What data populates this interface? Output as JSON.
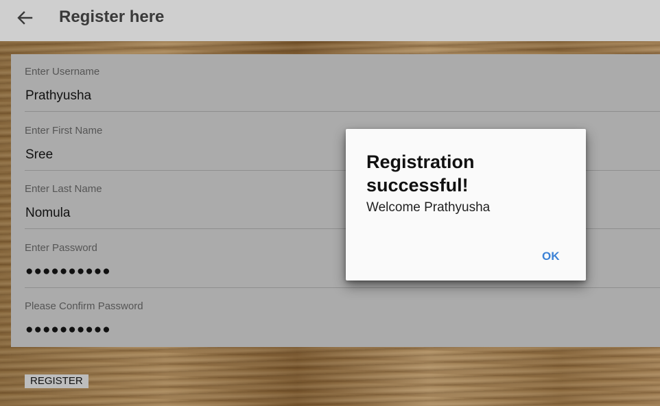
{
  "toolbar": {
    "title": "Register here",
    "back_icon": "arrow-left-icon"
  },
  "form": {
    "fields": [
      {
        "label": "Enter Username",
        "value": "Prathyusha"
      },
      {
        "label": "Enter First Name",
        "value": "Sree"
      },
      {
        "label": "Enter Last Name",
        "value": "Nomula"
      },
      {
        "label": "Enter Password",
        "value": "●●●●●●●●●●"
      },
      {
        "label": "Please Confirm Password",
        "value": "●●●●●●●●●●"
      }
    ],
    "register_label": "REGISTER"
  },
  "dialog": {
    "title": "Registration successful!",
    "message": "Welcome Prathyusha",
    "ok_label": "OK"
  },
  "colors": {
    "toolbar": "#cfcfcf",
    "form_bg": "#ababab",
    "dialog_accent": "#3c82d6"
  }
}
